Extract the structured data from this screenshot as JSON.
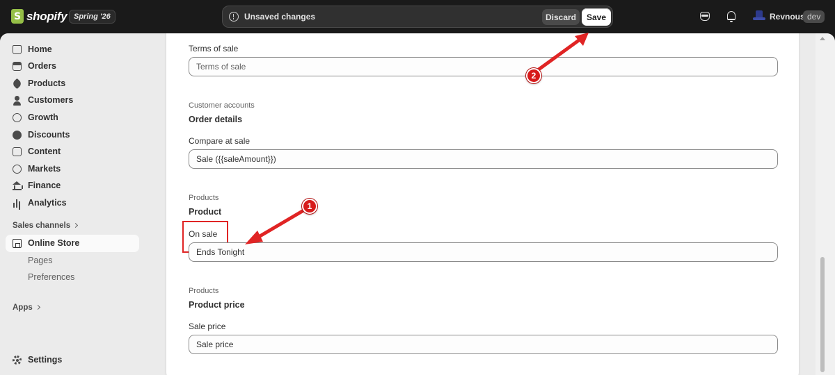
{
  "topbar": {
    "logo_text": "shopify",
    "edition": "Spring '26",
    "unsaved_text": "Unsaved changes",
    "discard_label": "Discard",
    "save_label": "Save",
    "store_name": "Revnous",
    "dev_badge": "dev"
  },
  "sidebar": {
    "items": [
      {
        "label": "Home",
        "icon": "home-icon"
      },
      {
        "label": "Orders",
        "icon": "orders-icon"
      },
      {
        "label": "Products",
        "icon": "tag-icon"
      },
      {
        "label": "Customers",
        "icon": "person-icon"
      },
      {
        "label": "Growth",
        "icon": "growth-icon"
      },
      {
        "label": "Discounts",
        "icon": "discount-icon"
      },
      {
        "label": "Content",
        "icon": "content-icon"
      },
      {
        "label": "Markets",
        "icon": "globe-icon"
      },
      {
        "label": "Finance",
        "icon": "bank-icon"
      },
      {
        "label": "Analytics",
        "icon": "analytics-icon"
      }
    ],
    "sales_channels_label": "Sales channels",
    "online_store_label": "Online Store",
    "sub_items": [
      "Pages",
      "Preferences"
    ],
    "apps_label": "Apps",
    "settings_label": "Settings"
  },
  "main": {
    "terms": {
      "label": "Terms of sale",
      "placeholder": "Terms of sale",
      "value": ""
    },
    "order_details": {
      "group": "Customer accounts",
      "title": "Order details",
      "label": "Compare at sale",
      "value": "Sale ({{saleAmount}})"
    },
    "product": {
      "group": "Products",
      "title": "Product",
      "label": "On sale",
      "value": "Ends Tonight"
    },
    "product_price": {
      "group": "Products",
      "title": "Product price",
      "label": "Sale price",
      "value": "Sale price"
    }
  },
  "annotations": {
    "step1": "1",
    "step2": "2",
    "color": "#e02424"
  }
}
